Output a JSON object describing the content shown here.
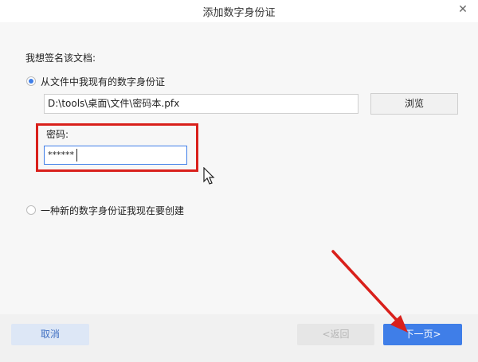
{
  "window": {
    "title": "添加数字身份证",
    "close_glyph": "✕"
  },
  "form": {
    "sign_label": "我想签名该文档:",
    "option_existing": "从文件中我现有的数字身份证",
    "file_path": "D:\\tools\\桌面\\文件\\密码本.pfx",
    "browse_label": "浏览",
    "password_label": "密码:",
    "password_value": "******",
    "option_new": "一种新的数字身份证我现在要创建"
  },
  "footer": {
    "cancel_label": "取消",
    "back_label": "<返回",
    "next_label": "下一页>"
  },
  "colors": {
    "accent": "#3f7ee8",
    "highlight": "#d9201b"
  }
}
